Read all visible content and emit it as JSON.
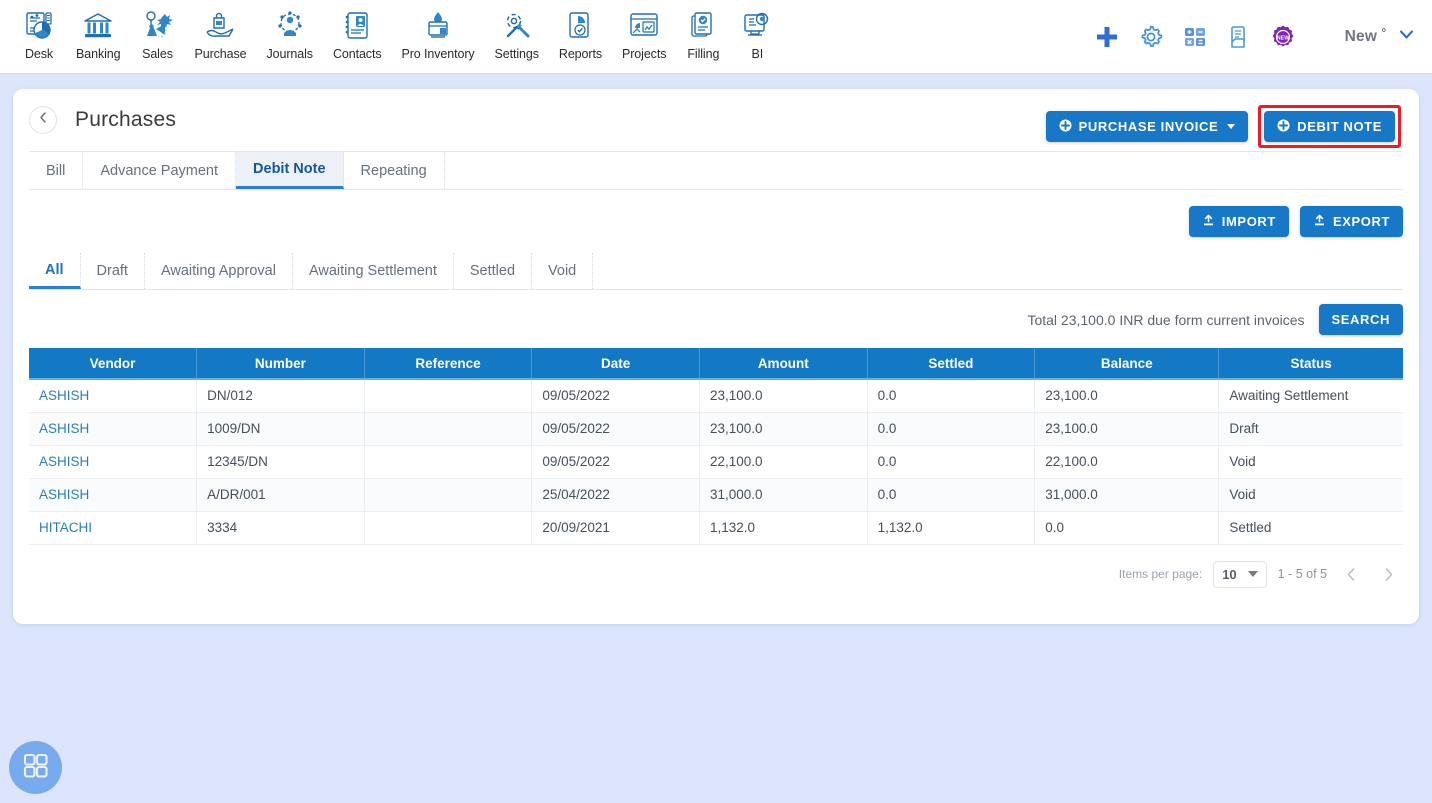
{
  "topnav": {
    "items": [
      {
        "label": "Desk",
        "icon": "dashboard-icon"
      },
      {
        "label": "Banking",
        "icon": "bank-icon"
      },
      {
        "label": "Sales",
        "icon": "sales-icon"
      },
      {
        "label": "Purchase",
        "icon": "purchase-icon"
      },
      {
        "label": "Journals",
        "icon": "journals-icon"
      },
      {
        "label": "Contacts",
        "icon": "contacts-icon"
      },
      {
        "label": "Pro Inventory",
        "icon": "inventory-icon"
      },
      {
        "label": "Settings",
        "icon": "settings-icon"
      },
      {
        "label": "Reports",
        "icon": "reports-icon"
      },
      {
        "label": "Projects",
        "icon": "projects-icon"
      },
      {
        "label": "Filling",
        "icon": "filling-icon"
      },
      {
        "label": "BI",
        "icon": "bi-icon"
      }
    ],
    "right_icons": [
      {
        "name": "add-plus-icon",
        "color": "#2f6fd0"
      },
      {
        "name": "gear-icon",
        "color": "#3f8fd8"
      },
      {
        "name": "calculator-icon",
        "color": "#4a8fd8"
      },
      {
        "name": "document-copy-icon",
        "color": "#4a9ad8"
      },
      {
        "name": "new-badge-icon",
        "color": "#8024b8"
      }
    ],
    "account_label": "New ˚"
  },
  "header": {
    "title": "Purchases",
    "back_icon": "chevron-left-icon",
    "purchase_invoice_button": "PURCHASE INVOICE",
    "debit_note_button": "DEBIT NOTE",
    "highlight_color": "#ee1c25"
  },
  "type_tabs": [
    {
      "label": "Bill",
      "active": false
    },
    {
      "label": "Advance Payment",
      "active": false
    },
    {
      "label": "Debit Note",
      "active": true
    },
    {
      "label": "Repeating",
      "active": false
    }
  ],
  "toolbar": {
    "import_label": "IMPORT",
    "export_label": "EXPORT"
  },
  "status_tabs": [
    {
      "label": "All",
      "active": true
    },
    {
      "label": "Draft",
      "active": false
    },
    {
      "label": "Awaiting Approval",
      "active": false
    },
    {
      "label": "Awaiting Settlement",
      "active": false
    },
    {
      "label": "Settled",
      "active": false
    },
    {
      "label": "Void",
      "active": false
    }
  ],
  "search": {
    "total_text": "Total 23,100.0 INR due form current invoices",
    "button_label": "SEARCH"
  },
  "table": {
    "columns": [
      "Vendor",
      "Number",
      "Reference",
      "Date",
      "Amount",
      "Settled",
      "Balance",
      "Status"
    ],
    "rows": [
      {
        "vendor": "ASHISH",
        "number": "DN/012",
        "reference": "",
        "date": "09/05/2022",
        "amount": "23,100.0",
        "settled": "0.0",
        "balance": "23,100.0",
        "status": "Awaiting Settlement"
      },
      {
        "vendor": "ASHISH",
        "number": "1009/DN",
        "reference": "",
        "date": "09/05/2022",
        "amount": "23,100.0",
        "settled": "0.0",
        "balance": "23,100.0",
        "status": "Draft"
      },
      {
        "vendor": "ASHISH",
        "number": "12345/DN",
        "reference": "",
        "date": "09/05/2022",
        "amount": "22,100.0",
        "settled": "0.0",
        "balance": "22,100.0",
        "status": "Void"
      },
      {
        "vendor": "ASHISH",
        "number": "A/DR/001",
        "reference": "",
        "date": "25/04/2022",
        "amount": "31,000.0",
        "settled": "0.0",
        "balance": "31,000.0",
        "status": "Void"
      },
      {
        "vendor": "HITACHI",
        "number": "3334",
        "reference": "",
        "date": "20/09/2021",
        "amount": "1,132.0",
        "settled": "1,132.0",
        "balance": "0.0",
        "status": "Settled"
      }
    ]
  },
  "paginator": {
    "items_per_page_label": "Items per page:",
    "items_per_page_value": "10",
    "range_label": "1 - 5 of 5",
    "prev_icon": "chevron-left-icon",
    "next_icon": "chevron-right-icon"
  },
  "fab": {
    "name": "apps-grid-fab",
    "icon": "grid-icon"
  }
}
